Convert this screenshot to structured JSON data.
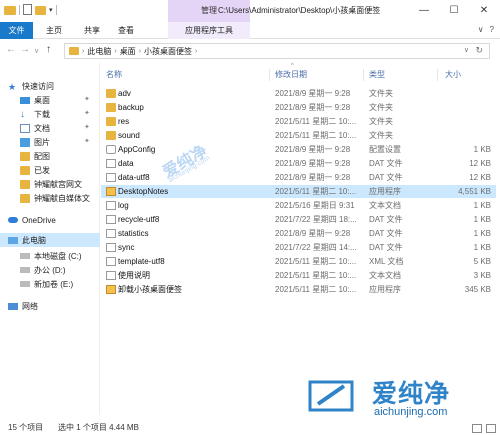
{
  "title_bar": {
    "context_tab_header": "管理",
    "path_title": "C:\\Users\\Administrator\\Desktop\\小孩桌面便签",
    "minimize": "—",
    "maximize": "☐",
    "close": "✕"
  },
  "ribbon": {
    "tabs": [
      "文件",
      "主页",
      "共享",
      "查看",
      "应用程序工具"
    ],
    "collapse_glyph": "∨",
    "help_glyph": "?"
  },
  "address": {
    "crumbs": [
      "此电脑",
      "桌面",
      "小孩桌面便签"
    ],
    "back": "←",
    "forward": "→",
    "up_menu": "∨",
    "up": "↑",
    "dropdown": "∨",
    "refresh": "↻",
    "sep": "›"
  },
  "sidebar": {
    "items": [
      {
        "label": "快速访问",
        "icon": "star-icon"
      },
      {
        "label": "桌面",
        "icon": "desktop-icon"
      },
      {
        "label": "下载",
        "icon": "download-icon"
      },
      {
        "label": "文档",
        "icon": "documents-icon"
      },
      {
        "label": "图片",
        "icon": "pictures-icon"
      },
      {
        "label": "配图",
        "icon": "folder-icon"
      },
      {
        "label": "已发",
        "icon": "folder-icon"
      },
      {
        "label": "钟耀献宫网文",
        "icon": "folder-icon"
      },
      {
        "label": "钟耀献自媒体文",
        "icon": "folder-icon"
      },
      {
        "label": "OneDrive",
        "icon": "cloud-icon"
      },
      {
        "label": "此电脑",
        "icon": "computer-icon"
      },
      {
        "label": "本地磁盘 (C:)",
        "icon": "drive-icon"
      },
      {
        "label": "办公 (D:)",
        "icon": "drive-icon"
      },
      {
        "label": "新加卷 (E:)",
        "icon": "drive-icon"
      },
      {
        "label": "网络",
        "icon": "network-icon"
      }
    ],
    "pin_glyph": "📌"
  },
  "columns": {
    "name": "名称",
    "date": "修改日期",
    "type": "类型",
    "size": "大小",
    "sort_glyph": "^"
  },
  "files": [
    {
      "name": "adv",
      "date": "2021/8/9 星期一 9:28",
      "type": "文件夹",
      "size": "",
      "icon": "folder-icon"
    },
    {
      "name": "backup",
      "date": "2021/8/9 星期一 9:28",
      "type": "文件夹",
      "size": "",
      "icon": "folder-icon"
    },
    {
      "name": "res",
      "date": "2021/5/11 星期二 10:...",
      "type": "文件夹",
      "size": "",
      "icon": "folder-icon"
    },
    {
      "name": "sound",
      "date": "2021/5/11 星期二 10:...",
      "type": "文件夹",
      "size": "",
      "icon": "folder-icon"
    },
    {
      "name": "AppConfig",
      "date": "2021/8/9 星期一 9:28",
      "type": "配置设置",
      "size": "1 KB",
      "icon": "config-file-icon"
    },
    {
      "name": "data",
      "date": "2021/8/9 星期一 9:28",
      "type": "DAT 文件",
      "size": "12 KB",
      "icon": "file-icon"
    },
    {
      "name": "data-utf8",
      "date": "2021/8/9 星期一 9:28",
      "type": "DAT 文件",
      "size": "12 KB",
      "icon": "file-icon"
    },
    {
      "name": "DesktopNotes",
      "date": "2021/5/11 星期二 10:...",
      "type": "应用程序",
      "size": "4,551 KB",
      "icon": "app-icon",
      "selected": true
    },
    {
      "name": "log",
      "date": "2021/5/16 星期日 9:31",
      "type": "文本文档",
      "size": "1 KB",
      "icon": "text-file-icon"
    },
    {
      "name": "recycle-utf8",
      "date": "2021/7/22 星期四 18:...",
      "type": "DAT 文件",
      "size": "1 KB",
      "icon": "file-icon"
    },
    {
      "name": "statistics",
      "date": "2021/8/9 星期一 9:28",
      "type": "DAT 文件",
      "size": "1 KB",
      "icon": "file-icon"
    },
    {
      "name": "sync",
      "date": "2021/7/22 星期四 14:...",
      "type": "DAT 文件",
      "size": "1 KB",
      "icon": "file-icon"
    },
    {
      "name": "template-utf8",
      "date": "2021/5/11 星期二 10:...",
      "type": "XML 文档",
      "size": "5 KB",
      "icon": "file-icon"
    },
    {
      "name": "使用说明",
      "date": "2021/5/11 星期二 10:...",
      "type": "文本文档",
      "size": "3 KB",
      "icon": "text-file-icon"
    },
    {
      "name": "卸载小孩桌面便签",
      "date": "2021/5/11 星期二 10:...",
      "type": "应用程序",
      "size": "345 KB",
      "icon": "uninstall-app-icon"
    }
  ],
  "status": {
    "count": "15 个项目",
    "selected": "选中 1 个项目  4.44 MB"
  },
  "watermark": {
    "center": "爱纯净",
    "center_url": "aichunjing.com",
    "logo_text": "爱纯净",
    "logo_url": "aichunjing.com"
  },
  "colors": {
    "file_tab": "#1979ca",
    "context_tab": "#e4d5f6",
    "selection": "#cce8ff",
    "folder": "#e8b440",
    "header_text": "#4a6ea9",
    "watermark": "#2f84c9"
  }
}
